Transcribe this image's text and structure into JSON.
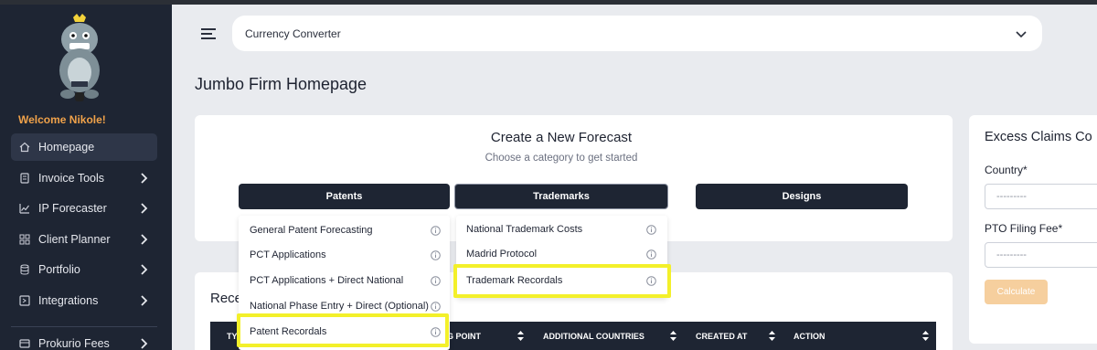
{
  "sidebar": {
    "welcome": "Welcome Nikole!",
    "items": [
      {
        "label": "Homepage",
        "icon": "home-icon",
        "active": true,
        "has_chevron": false
      },
      {
        "label": "Invoice Tools",
        "icon": "invoice-icon",
        "active": false,
        "has_chevron": true
      },
      {
        "label": "IP Forecaster",
        "icon": "chart-icon",
        "active": false,
        "has_chevron": true
      },
      {
        "label": "Client Planner",
        "icon": "grid-icon",
        "active": false,
        "has_chevron": true
      },
      {
        "label": "Portfolio",
        "icon": "database-icon",
        "active": false,
        "has_chevron": true
      },
      {
        "label": "Integrations",
        "icon": "integration-icon",
        "active": false,
        "has_chevron": true
      },
      {
        "label": "Prokurio Fees",
        "icon": "fees-icon",
        "active": false,
        "has_chevron": true
      }
    ]
  },
  "header": {
    "currency_converter": "Currency Converter"
  },
  "page": {
    "title": "Jumbo Firm Homepage"
  },
  "forecast": {
    "title": "Create a New Forecast",
    "subtitle": "Choose a category to get started",
    "categories": [
      "Patents",
      "Trademarks",
      "Designs"
    ],
    "patent_menu": [
      "General Patent Forecasting",
      "PCT Applications",
      "PCT Applications + Direct National",
      "National Phase Entry + Direct (Optional)",
      "Patent Recordals"
    ],
    "trademark_menu": [
      "National Trademark Costs",
      "Madrid Protocol",
      "Trademark Recordals"
    ]
  },
  "recent": {
    "title": "Rece",
    "columns": [
      "TY",
      "ING POINT",
      "ADDITIONAL COUNTRIES",
      "CREATED AT",
      "ACTION"
    ]
  },
  "excess_claims": {
    "title": "Excess Claims Co",
    "country_label": "Country*",
    "country_value": "---------",
    "fee_label": "PTO Filing Fee*",
    "fee_value": "---------",
    "calculate": "Calculate"
  },
  "colors": {
    "sidebar_bg": "#1e2533",
    "accent_orange": "#f0a24a",
    "highlight_yellow": "#f3f02a",
    "calculate_bg": "#f6cf9e"
  }
}
